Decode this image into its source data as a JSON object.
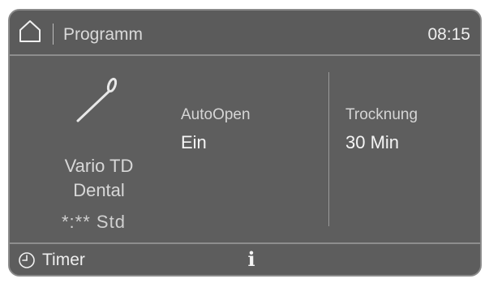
{
  "header": {
    "home_icon": "home-icon",
    "title": "Programm",
    "time": "08:15"
  },
  "program": {
    "icon": "dental-instrument-icon",
    "name_line1": "Vario TD",
    "name_line2": "Dental",
    "duration": "*:** Std"
  },
  "settings": {
    "autoopen": {
      "label": "AutoOpen",
      "value": "Ein"
    },
    "drying": {
      "label": "Trocknung",
      "value": "30 Min"
    }
  },
  "footer": {
    "timer_icon": "clock-icon",
    "timer_label": "Timer",
    "info_icon": "info-icon",
    "info_glyph": "i"
  },
  "colors": {
    "screen_bg": "#5e5e5e",
    "border": "#8a8a8a",
    "text_primary": "#f5f5f5",
    "text_secondary": "#d5d5d5"
  }
}
